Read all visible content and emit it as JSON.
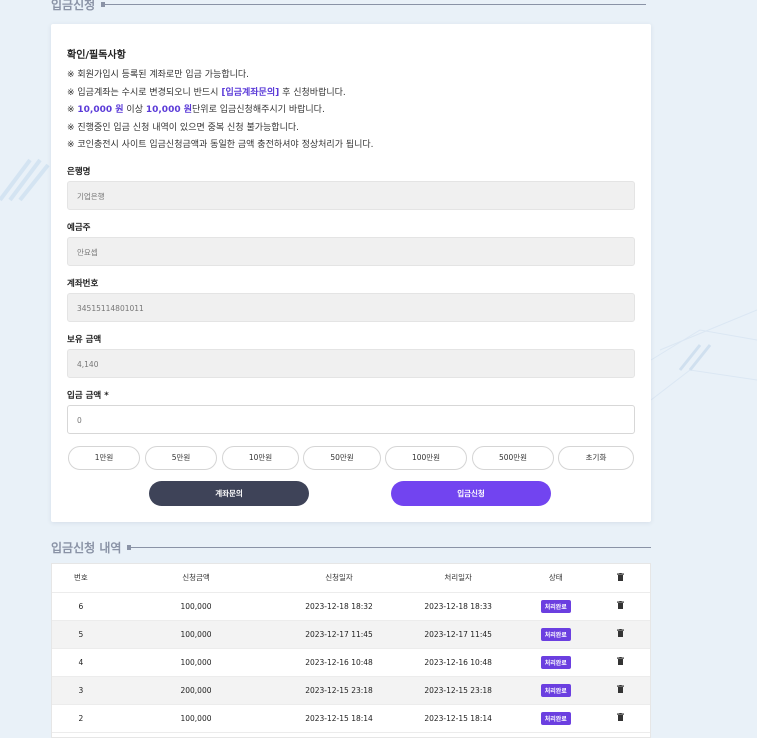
{
  "deposit_section": {
    "title": "입금신청"
  },
  "notice": {
    "title": "확인/필독사항",
    "line1": "※ 회원가입시 등록된 계좌로만 입금 가능합니다.",
    "line2_pre": "※ 입금계좌는 수시로 변경되오니 반드시 ",
    "line2_hl": "[입금계좌문의]",
    "line2_post": " 후 신청바랍니다.",
    "line3_pre": "※ ",
    "line3_min": "10,000 원",
    "line3_mid": " 이상 ",
    "line3_unit": "10,000 원",
    "line3_post": "단위로 입금신청해주시기 바랍니다.",
    "line4": "※ 진행중인 입금 신청 내역이 있으면 중복 신청 불가능합니다.",
    "line5": "※ 코인충전시 사이트 입금신청금액과 동일한 금액 충전하셔야 정상처리가 됩니다."
  },
  "form": {
    "bank_label": "은행명",
    "bank_value": "기업은행",
    "holder_label": "예금주",
    "holder_value": "안요셉",
    "account_label": "계좌번호",
    "account_value": "34515114801011",
    "balance_label": "보유 금액",
    "balance_value": "4,140",
    "amount_label": "입금 금액 *",
    "amount_value": "0"
  },
  "amount_buttons": [
    "1만원",
    "5만원",
    "10만원",
    "50만원",
    "100만원",
    "500만원",
    "초기화"
  ],
  "actions": {
    "inquiry": "계좌문의",
    "apply": "입금신청"
  },
  "history": {
    "title": "입금신청 내역",
    "columns": [
      "번호",
      "신청금액",
      "신청일자",
      "처리일자",
      "상태",
      "삭제"
    ],
    "rows": [
      {
        "no": "6",
        "amount": "100,000",
        "requested": "2023-12-18 18:32",
        "processed": "2023-12-18 18:33",
        "status": "처리완료"
      },
      {
        "no": "5",
        "amount": "100,000",
        "requested": "2023-12-17 11:45",
        "processed": "2023-12-17 11:45",
        "status": "처리완료"
      },
      {
        "no": "4",
        "amount": "100,000",
        "requested": "2023-12-16 10:48",
        "processed": "2023-12-16 10:48",
        "status": "처리완료"
      },
      {
        "no": "3",
        "amount": "200,000",
        "requested": "2023-12-15 23:18",
        "processed": "2023-12-15 23:18",
        "status": "처리완료"
      },
      {
        "no": "2",
        "amount": "100,000",
        "requested": "2023-12-15 18:14",
        "processed": "2023-12-15 18:14",
        "status": "처리완료"
      }
    ]
  },
  "colors": {
    "accent": "#7244f0",
    "dark_button": "#3e4358",
    "highlight": "#5b3bd8",
    "background": "#e9f1f8"
  }
}
